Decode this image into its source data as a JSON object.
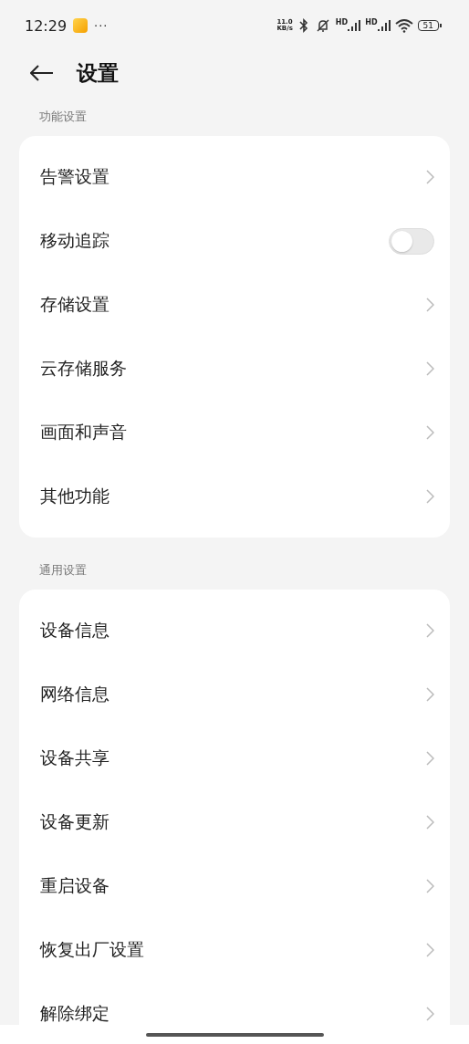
{
  "status_bar": {
    "time": "12:29",
    "more": "···",
    "net_speed": [
      "11.0",
      "KB/s"
    ],
    "sim_labels": [
      "HD",
      "HD"
    ],
    "battery": "51"
  },
  "header": {
    "title": "设置"
  },
  "sections": [
    {
      "label": "功能设置",
      "items": [
        {
          "kind": "link",
          "label": "告警设置"
        },
        {
          "kind": "toggle",
          "label": "移动追踪",
          "on": false
        },
        {
          "kind": "link",
          "label": "存储设置"
        },
        {
          "kind": "link",
          "label": "云存储服务"
        },
        {
          "kind": "link",
          "label": "画面和声音"
        },
        {
          "kind": "link",
          "label": "其他功能"
        }
      ]
    },
    {
      "label": "通用设置",
      "items": [
        {
          "kind": "link",
          "label": "设备信息"
        },
        {
          "kind": "link",
          "label": "网络信息"
        },
        {
          "kind": "link",
          "label": "设备共享"
        },
        {
          "kind": "link",
          "label": "设备更新"
        },
        {
          "kind": "link",
          "label": "重启设备"
        },
        {
          "kind": "link",
          "label": "恢复出厂设置"
        },
        {
          "kind": "link",
          "label": "解除绑定"
        }
      ]
    }
  ]
}
